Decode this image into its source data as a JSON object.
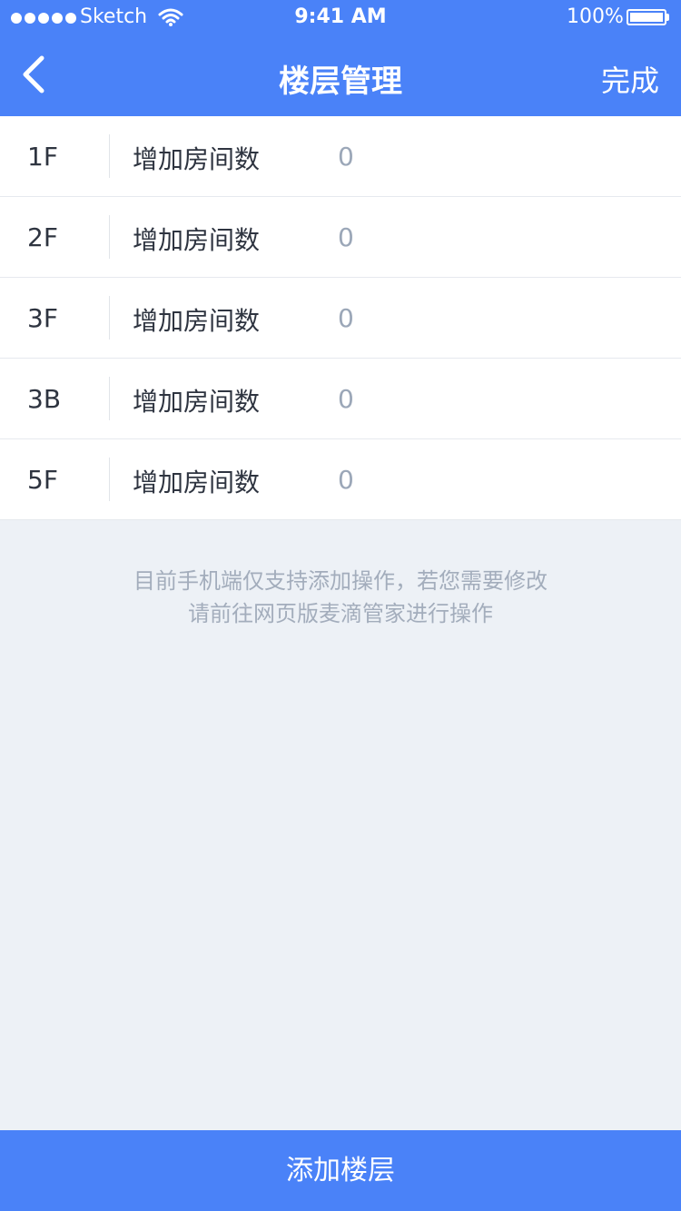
{
  "status_bar": {
    "carrier": "Sketch",
    "time": "9:41 AM",
    "battery": "100%"
  },
  "header": {
    "title": "楼层管理",
    "done_label": "完成"
  },
  "floors": [
    {
      "floor": "1F",
      "label": "增加房间数",
      "value": "0"
    },
    {
      "floor": "2F",
      "label": "增加房间数",
      "value": "0"
    },
    {
      "floor": "3F",
      "label": "增加房间数",
      "value": "0"
    },
    {
      "floor": "3B",
      "label": "增加房间数",
      "value": "0"
    },
    {
      "floor": "5F",
      "label": "增加房间数",
      "value": "0"
    }
  ],
  "note": {
    "line1": "目前手机端仅支持添加操作，若您需要修改",
    "line2": "请前往网页版麦滴管家进行操作"
  },
  "footer": {
    "add_label": "添加楼层"
  },
  "colors": {
    "primary": "#4a82f8",
    "background": "#edf1f6",
    "muted_text": "#9ba7b8"
  },
  "icons": {
    "back": "chevron-left-icon",
    "wifi": "wifi-icon",
    "battery": "battery-icon"
  }
}
